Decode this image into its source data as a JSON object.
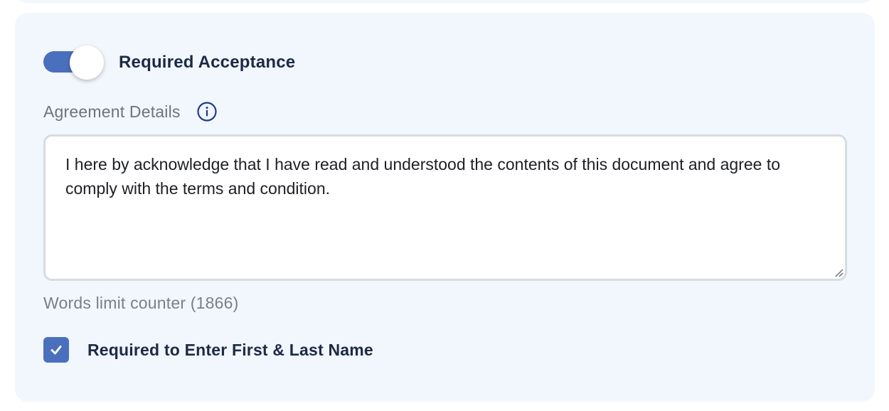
{
  "agreement": {
    "required_toggle": {
      "label": "Required Acceptance",
      "on": true
    },
    "details_label": "Agreement Details",
    "info_icon": "info-circle-icon",
    "textarea_value": "I here by acknowledge that I have read and understood the contents of this document and agree to comply with the terms and condition.",
    "word_counter": "Words limit counter (1866)",
    "name_checkbox": {
      "label": "Required to Enter First & Last Name",
      "checked": true
    }
  },
  "colors": {
    "panel_bg": "#f2f6fd",
    "accent": "#4a6fbd",
    "heading_text": "#1c2a45",
    "muted_text": "#6f7379",
    "info_icon": "#1f3b8a"
  }
}
